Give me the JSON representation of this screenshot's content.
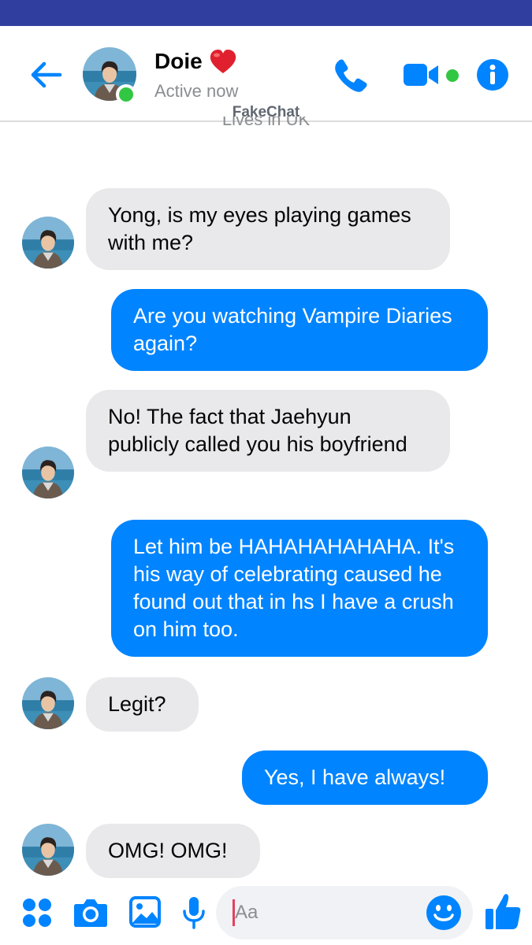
{
  "header": {
    "contact_name": "Doie",
    "status": "Active now",
    "watermark": "FakeChat",
    "subtitle_partial": "Lives in UK"
  },
  "messages": [
    {
      "side": "in",
      "text": "Yong, is my eyes playing games with me?"
    },
    {
      "side": "out",
      "text": "Are you watching Vampire Diaries again?"
    },
    {
      "side": "in",
      "text": "No! The fact that Jaehyun publicly called you his boyfriend"
    },
    {
      "side": "out",
      "text": "Let him be HAHAHAHAHAHA. It's his way of celebrating caused he found out that in hs I have a crush on him too."
    },
    {
      "side": "in",
      "text": "Legit?"
    },
    {
      "side": "out",
      "text": "Yes, I have always!"
    },
    {
      "side": "in",
      "text": "OMG! OMG!"
    }
  ],
  "composer": {
    "placeholder": "Aa"
  },
  "colors": {
    "accent": "#0084ff",
    "status_bar": "#303f9f",
    "incoming_bubble": "#e9e9eb",
    "online": "#31c742"
  },
  "icons": {
    "back": "arrow-left-icon",
    "call": "phone-icon",
    "video": "video-camera-icon",
    "info": "info-icon",
    "apps": "four-dots-icon",
    "camera": "camera-icon",
    "gallery": "image-icon",
    "voice": "microphone-icon",
    "emoji": "smiley-icon",
    "like": "thumbs-up-icon"
  }
}
